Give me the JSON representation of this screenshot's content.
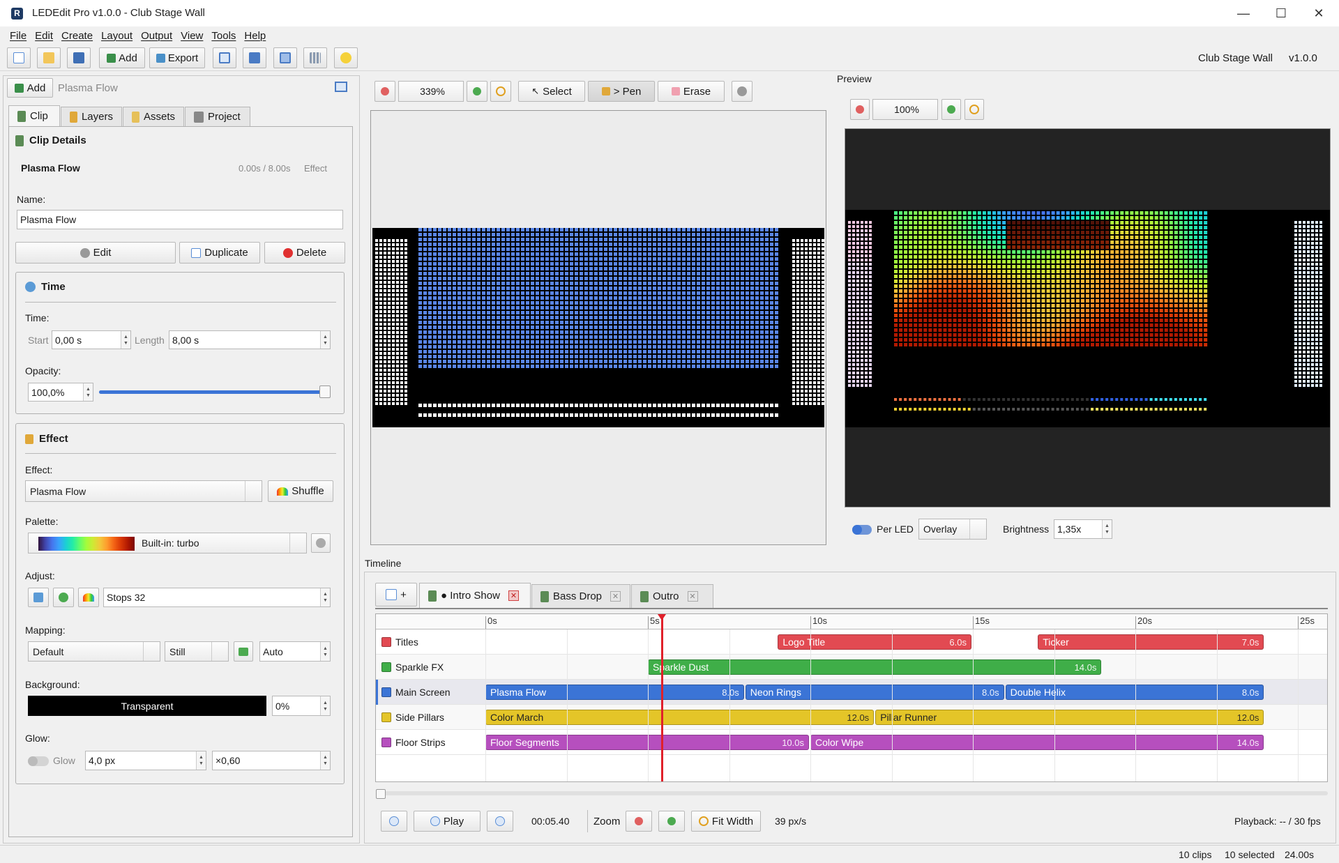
{
  "window": {
    "title": "LEDEdit Pro v1.0.0 - Club Stage Wall",
    "app_icon": "R",
    "min": "—",
    "max": "☐",
    "close": "✕"
  },
  "menu": [
    "File",
    "Edit",
    "Create",
    "Layout",
    "Output",
    "View",
    "Tools",
    "Help"
  ],
  "toolbar": {
    "add": "Add",
    "export": "Export",
    "project_name": "Club Stage Wall",
    "version": "v1.0.0"
  },
  "left": {
    "add": "Add",
    "clip_name_header": "Plasma Flow",
    "tabs": [
      "Clip",
      "Layers",
      "Assets",
      "Project"
    ],
    "clip_details": {
      "title": "Clip Details",
      "name": "Plasma Flow",
      "time": "0.00s / 8.00s",
      "kind": "Effect",
      "name_label": "Name:",
      "name_value": "Plasma Flow",
      "edit": "Edit",
      "duplicate": "Duplicate",
      "delete": "Delete"
    },
    "time": {
      "title": "Time",
      "time_label": "Time:",
      "start_label": "Start",
      "start": "0,00 s",
      "length_label": "Length",
      "length": "8,00 s",
      "opacity_label": "Opacity:",
      "opacity": "100,0%",
      "opacity_fraction": 1.0
    },
    "effect": {
      "title": "Effect",
      "effect_label": "Effect:",
      "effect": "Plasma Flow",
      "shuffle": "Shuffle",
      "palette_label": "Palette:",
      "palette": "Built-in: turbo",
      "adjust_label": "Adjust:",
      "stops": "Stops 32",
      "mapping_label": "Mapping:",
      "mapping": "Default",
      "mode": "Still",
      "auto": "Auto",
      "background_label": "Background:",
      "background": "Transparent",
      "bg_opacity": "0%",
      "glow_label": "Glow:",
      "glow": "Glow",
      "glow_px": "4,0 px",
      "glow_mult": "×0,60"
    }
  },
  "editor": {
    "zoom": "339%",
    "select": "Select",
    "pen": "> Pen",
    "erase": "Erase"
  },
  "preview": {
    "title": "Preview",
    "zoom": "100%",
    "per_led": "Per LED",
    "overlay": "Overlay",
    "brightness_label": "Brightness",
    "brightness": "1,35x"
  },
  "timeline": {
    "title": "Timeline",
    "new_tab": "+",
    "tabs": [
      {
        "label": "● Intro Show",
        "closable": true,
        "active": true
      },
      {
        "label": "Bass Drop",
        "closable": true
      },
      {
        "label": "Outro",
        "closable": true
      }
    ],
    "ruler": [
      "0s",
      "5s",
      "10s",
      "15s",
      "20s",
      "25s"
    ],
    "playhead_s": 5.4,
    "tracks": [
      {
        "name": "Titles",
        "color": "#e24a52",
        "clips": [
          {
            "name": "Logo Title",
            "dur": "6.0s",
            "start": 9,
            "len": 6
          },
          {
            "name": "Ticker",
            "dur": "7.0s",
            "start": 17,
            "len": 7
          }
        ]
      },
      {
        "name": "Sparkle FX",
        "color": "#3fae48",
        "clips": [
          {
            "name": "Sparkle Dust",
            "dur": "14.0s",
            "start": 5,
            "len": 14
          }
        ]
      },
      {
        "name": "Main Screen",
        "color": "#3b74d6",
        "clips": [
          {
            "name": "Plasma Flow",
            "dur": "8.0s",
            "start": 0,
            "len": 8
          },
          {
            "name": "Neon Rings",
            "dur": "8.0s",
            "start": 8,
            "len": 8
          },
          {
            "name": "Double Helix",
            "dur": "8.0s",
            "start": 16,
            "len": 8
          }
        ]
      },
      {
        "name": "Side Pillars",
        "color": "#e4c528",
        "clips": [
          {
            "name": "Color March",
            "dur": "12.0s",
            "start": 0,
            "len": 12
          },
          {
            "name": "Pillar Runner",
            "dur": "12.0s",
            "start": 12,
            "len": 12
          }
        ]
      },
      {
        "name": "Floor Strips",
        "color": "#b64fbe",
        "clips": [
          {
            "name": "Floor Segments",
            "dur": "10.0s",
            "start": 0,
            "len": 10
          },
          {
            "name": "Color Wipe",
            "dur": "14.0s",
            "start": 10,
            "len": 14
          }
        ]
      }
    ],
    "play": "Play",
    "time": "00:05.40",
    "zoom_label": "Zoom",
    "fit_width": "Fit Width",
    "pxs": "39 px/s",
    "playback": "Playback: -- / 30 fps"
  },
  "status": {
    "clips": "10 clips",
    "selected": "10 selected",
    "time": "24.00s"
  },
  "colors": {
    "accent": "#3b74d6",
    "playhead": "#e0202a"
  }
}
